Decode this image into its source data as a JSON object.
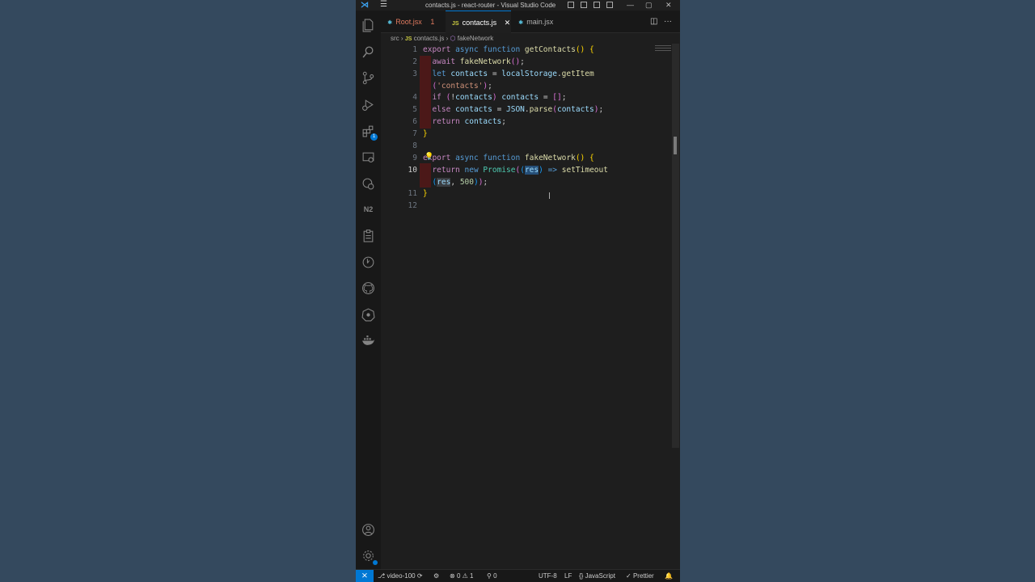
{
  "titlebar": {
    "title": "contacts.js - react-router - Visual Studio Code",
    "minimize": "—",
    "maximize": "▢",
    "close": "✕"
  },
  "activitybar": {
    "items": [
      "files-icon",
      "search-icon",
      "source-control-icon",
      "run-debug-icon",
      "extensions-icon",
      "remote-explorer-icon",
      "settings-sync-icon",
      "n2-icon",
      "clipboard-icon",
      "timeline-icon",
      "github-icon",
      "kubernetes-icon",
      "docker-icon"
    ],
    "extensions_badge": "1"
  },
  "tabs": [
    {
      "label": "Root.jsx",
      "badge": "1",
      "icon": "⚛"
    },
    {
      "label": "contacts.js",
      "icon": "JS",
      "close": "✕"
    },
    {
      "label": "main.jsx",
      "icon": "⚛"
    }
  ],
  "breadcrumb": {
    "folder": "src",
    "sep": "›",
    "file_icon": "JS",
    "file": "contacts.js",
    "symbol_icon": "⬡",
    "symbol": "fakeNetwork"
  },
  "gutter": [
    "1",
    "2",
    "3",
    "",
    "4",
    "5",
    "6",
    "7",
    "8",
    "9",
    "10",
    "",
    "11",
    "12"
  ],
  "active_line": "10",
  "statusbar": {
    "branch": "video-100",
    "errors": "0",
    "warnings": "1",
    "ports": "0",
    "encoding": "UTF-8",
    "eol": "LF",
    "language": "JavaScript",
    "formatter": "Prettier"
  },
  "colors": {
    "keyword": "#569cd6",
    "control": "#c586c0",
    "function": "#dcdcaa",
    "variable": "#9cdcfe",
    "string": "#ce9178",
    "number": "#b5cea8",
    "accent": "#0078d4"
  }
}
